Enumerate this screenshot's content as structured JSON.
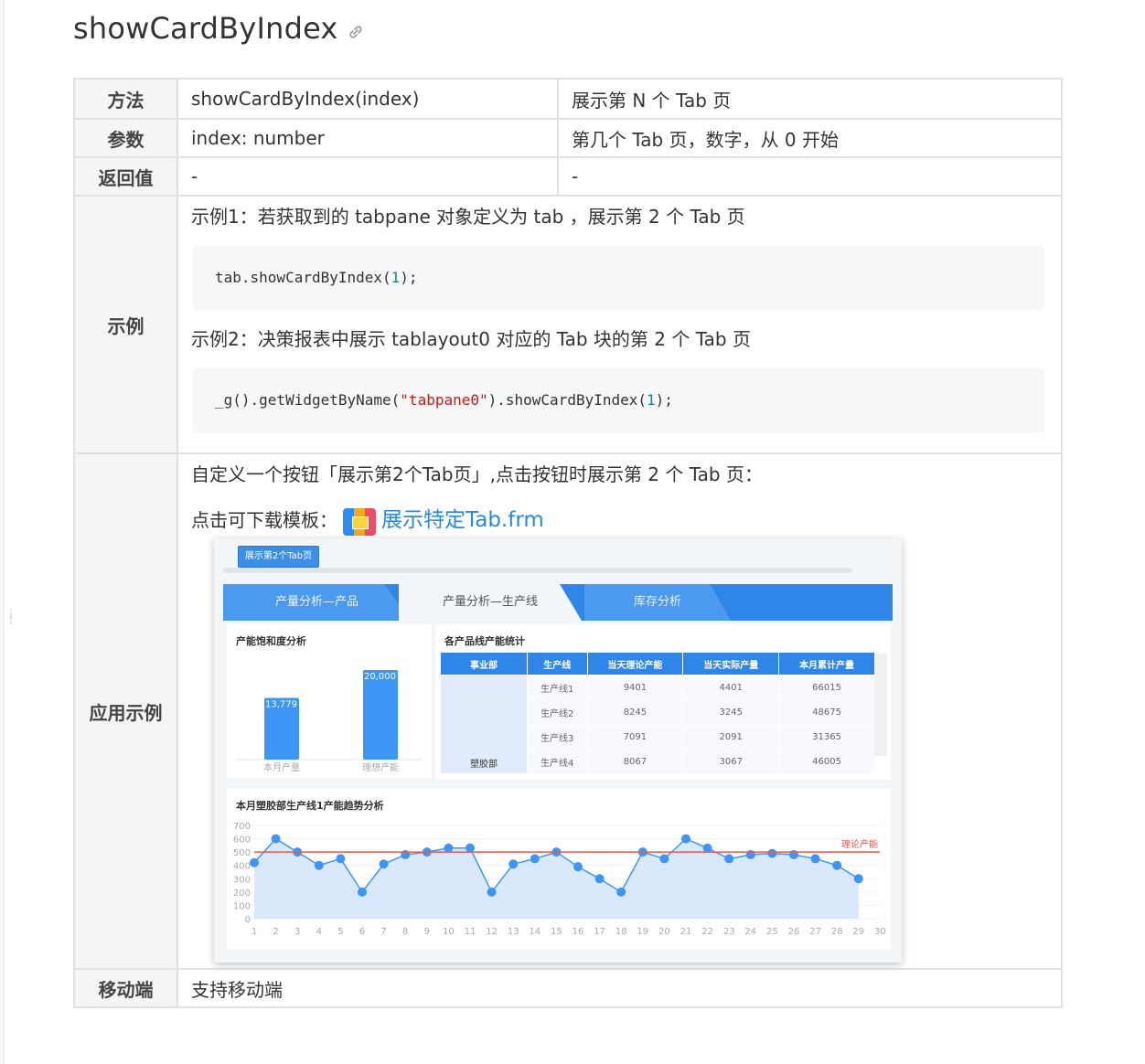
{
  "page": {
    "title": "showCardByIndex"
  },
  "table": {
    "rows": [
      {
        "key": "方法",
        "col1": "showCardByIndex(index)",
        "col2": "展示第 N 个 Tab 页"
      },
      {
        "key": "参数",
        "col1": "index: number",
        "col2": "第几个 Tab 页，数字，从 0 开始"
      },
      {
        "key": "返回值",
        "col1": "-",
        "col2": "-"
      }
    ],
    "example": {
      "key": "示例",
      "ex1_text": "示例1：若获取到的 tabpane 对象定义为 tab ，展示第 2 个 Tab 页",
      "ex1_code_a": "tab.showCardByIndex(",
      "ex1_code_num": "1",
      "ex1_code_b": ");",
      "ex2_text": "示例2：决策报表中展示 tablayout0 对应的 Tab 块的第 2 个 Tab 页",
      "ex2_code_a": "_g().getWidgetByName(",
      "ex2_code_str": "\"tabpane0\"",
      "ex2_code_b": ").showCardByIndex(",
      "ex2_code_num": "1",
      "ex2_code_c": ");"
    },
    "app": {
      "key": "应用示例",
      "desc": "自定义一个按钮「展示第2个Tab页」,点击按钮时展示第 2 个 Tab 页：",
      "download_label": "点击可下载模板：",
      "download_link": "展示特定Tab.frm"
    },
    "mobile": {
      "key": "移动端",
      "value": "支持移动端"
    }
  },
  "screenshot": {
    "button": "展示第2个Tab页",
    "tabs": [
      "产量分析—产品",
      "产量分析—生产线",
      "库存分析"
    ],
    "bar_panel": {
      "title": "产能饱和度分析",
      "bars": [
        {
          "label": "本月产量",
          "value": 13779,
          "text": "13,779"
        },
        {
          "label": "理想产能",
          "value": 20000,
          "text": "20,000"
        }
      ]
    },
    "table_panel": {
      "title": "各产品线产能统计",
      "headers": [
        "事业部",
        "生产线",
        "当天理论产能",
        "当天实际产量",
        "本月累计产量"
      ],
      "dept": "塑胶部",
      "rows": [
        [
          "生产线1",
          "9401",
          "4401",
          "66015"
        ],
        [
          "生产线2",
          "8245",
          "3245",
          "48675"
        ],
        [
          "生产线3",
          "7091",
          "2091",
          "31365"
        ],
        [
          "生产线4",
          "8067",
          "3067",
          "46005"
        ]
      ]
    },
    "line_panel": {
      "title": "本月塑胶部生产线1产能趋势分析",
      "ref_label": "理论产能"
    },
    "colors": {
      "accent": "#2f86e8",
      "bar": "#3d96f5",
      "ref_line": "#e8594f"
    }
  },
  "chart_data": {
    "type": "line",
    "title": "本月塑胶部生产线1产能趋势分析",
    "x": [
      1,
      2,
      3,
      4,
      5,
      6,
      7,
      8,
      9,
      10,
      11,
      12,
      13,
      14,
      15,
      16,
      17,
      18,
      19,
      20,
      21,
      22,
      23,
      24,
      25,
      26,
      27,
      28,
      29,
      30
    ],
    "series": [
      {
        "values": [
          420,
          600,
          500,
          400,
          450,
          200,
          410,
          480,
          500,
          530,
          530,
          200,
          410,
          450,
          500,
          390,
          300,
          200,
          500,
          450,
          600,
          530,
          450,
          480,
          490,
          480,
          450,
          400,
          300,
          null
        ]
      }
    ],
    "reference": {
      "name": "理论产能",
      "value": 500
    },
    "yticks": [
      0,
      100,
      200,
      300,
      400,
      500,
      600,
      700
    ],
    "ylim": [
      0,
      700
    ]
  }
}
